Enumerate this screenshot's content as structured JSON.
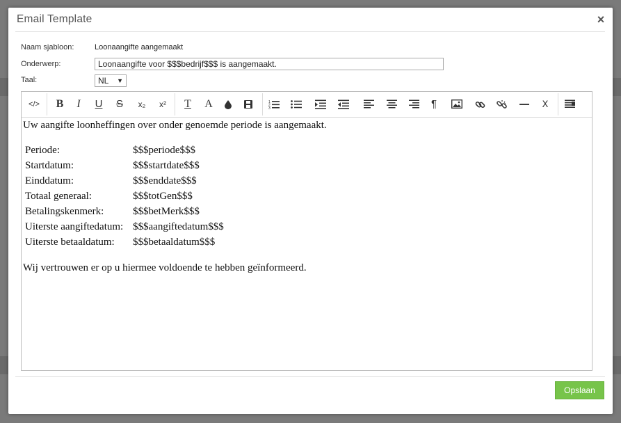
{
  "dialog": {
    "title": "Email Template",
    "close_label": "×"
  },
  "form": {
    "name_label": "Naam sjabloon:",
    "name_value": "Loonaangifte aangemaakt",
    "subject_label": "Onderwerp:",
    "subject_value": "Loonaangifte voor $$$bedrijf$$$ is aangemaakt.",
    "language_label": "Taal:",
    "language_value": "NL"
  },
  "toolbar": {
    "code": "</>",
    "bold": "B",
    "italic": "I",
    "underline": "U",
    "strike": "S",
    "subscript": "x₂",
    "superscript": "x²",
    "font_size": "T",
    "font_color": "A",
    "paragraph_mark": "¶",
    "clear_format": "Ⅹ"
  },
  "body": {
    "intro": "Uw aangifte loonheffingen over onder genoemde periode is aangemaakt.",
    "rows": [
      {
        "label": "Periode:",
        "value": "$$$periode$$$"
      },
      {
        "label": "Startdatum:",
        "value": "$$$startdate$$$"
      },
      {
        "label": "Einddatum:",
        "value": "$$$enddate$$$"
      },
      {
        "label": "Totaal generaal:",
        "value": "$$$totGen$$$"
      },
      {
        "label": "Betalingskenmerk:",
        "value": "$$$betMerk$$$"
      },
      {
        "label": "Uiterste aangiftedatum:",
        "value": "$$$aangiftedatum$$$"
      },
      {
        "label": "Uiterste betaaldatum:",
        "value": "$$$betaaldatum$$$"
      }
    ],
    "closing": "Wij vertrouwen er op u hiermee voldoende te hebben geïnformeerd."
  },
  "footer": {
    "save_label": "Opslaan"
  },
  "colors": {
    "save_button": "#77c44a"
  }
}
